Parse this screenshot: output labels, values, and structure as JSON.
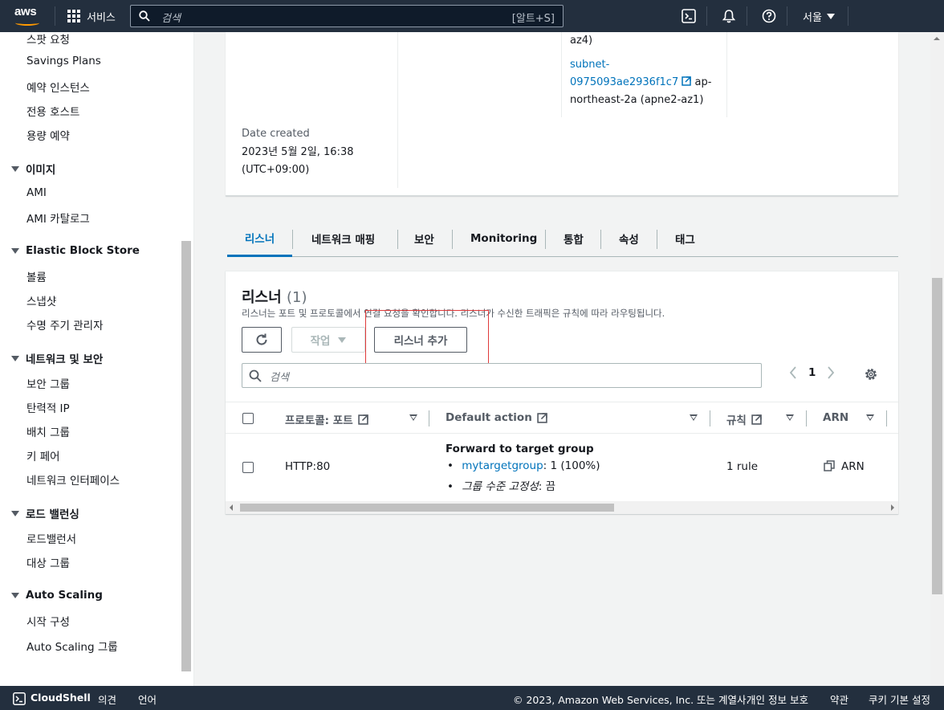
{
  "topnav": {
    "logo_text": "aws",
    "services_label": "서비스",
    "search_placeholder": "검색",
    "search_shortcut": "[알트+S]",
    "region": "서울"
  },
  "sidebar": {
    "items_top": [
      "스팟 요청",
      "Savings Plans",
      "예약 인스턴스",
      "전용 호스트",
      "용량 예약"
    ],
    "sections": [
      {
        "title": "이미지",
        "items": [
          "AMI",
          "AMI 카탈로그"
        ]
      },
      {
        "title": "Elastic Block Store",
        "items": [
          "볼륨",
          "스냅샷",
          "수명 주기 관리자"
        ]
      },
      {
        "title": "네트워크 및 보안",
        "items": [
          "보안 그룹",
          "탄력적 IP",
          "배치 그룹",
          "키 페어",
          "네트워크 인터페이스"
        ]
      },
      {
        "title": "로드 밸런싱",
        "items": [
          "로드밸런서",
          "대상 그룹"
        ]
      },
      {
        "title": "Auto Scaling",
        "items": [
          "시작 구성",
          "Auto Scaling 그룹"
        ]
      }
    ]
  },
  "details": {
    "az_tail": "az4)",
    "subnet_link_1": "subnet-",
    "subnet_link_2": "0975093ae2936f1c7",
    "subnet_suffix_1": "ap-",
    "subnet_suffix_2": "northeast-2a (apne2-az1)",
    "date_label": "Date created",
    "date_value_1": "2023년 5월 2일, 16:38",
    "date_value_2": "(UTC+09:00)"
  },
  "tabs": [
    "리스너",
    "네트워크 매핑",
    "보안",
    "Monitoring",
    "통합",
    "속성",
    "태그"
  ],
  "listeners": {
    "title": "리스너",
    "count": "(1)",
    "description": "리스너는 포트 및 프로토콜에서 연결 요청을 확인합니다. 리스너가 수신한 트래픽은 규칙에 따라 라우팅됩니다.",
    "actions_label": "작업",
    "add_label": "리스너 추가",
    "filter_placeholder": "검색",
    "page": "1",
    "columns": {
      "protocol": "프로토콜: 포트",
      "action": "Default action",
      "rules": "규칙",
      "arn": "ARN"
    },
    "row": {
      "protocol": "HTTP:80",
      "action_title": "Forward to target group",
      "target_link": "mytargetgroup",
      "target_weight": ": 1 (100%)",
      "stickiness_label": "그룹 수준 고정성",
      "stickiness_value": ": 끔",
      "rules": "1 rule",
      "arn": "ARN"
    }
  },
  "footer": {
    "cloudshell": "CloudShell",
    "feedback": "의견",
    "language": "언어",
    "copyright": "© 2023, Amazon Web Services, Inc. 또는 계열사.",
    "privacy": "개인 정보 보호",
    "terms": "약관",
    "cookies": "쿠키 기본 설정"
  },
  "colors": {
    "nav_bg": "#232f3e",
    "link": "#0073bb",
    "accent": "#ff9900",
    "highlight": "#e03a3a"
  }
}
